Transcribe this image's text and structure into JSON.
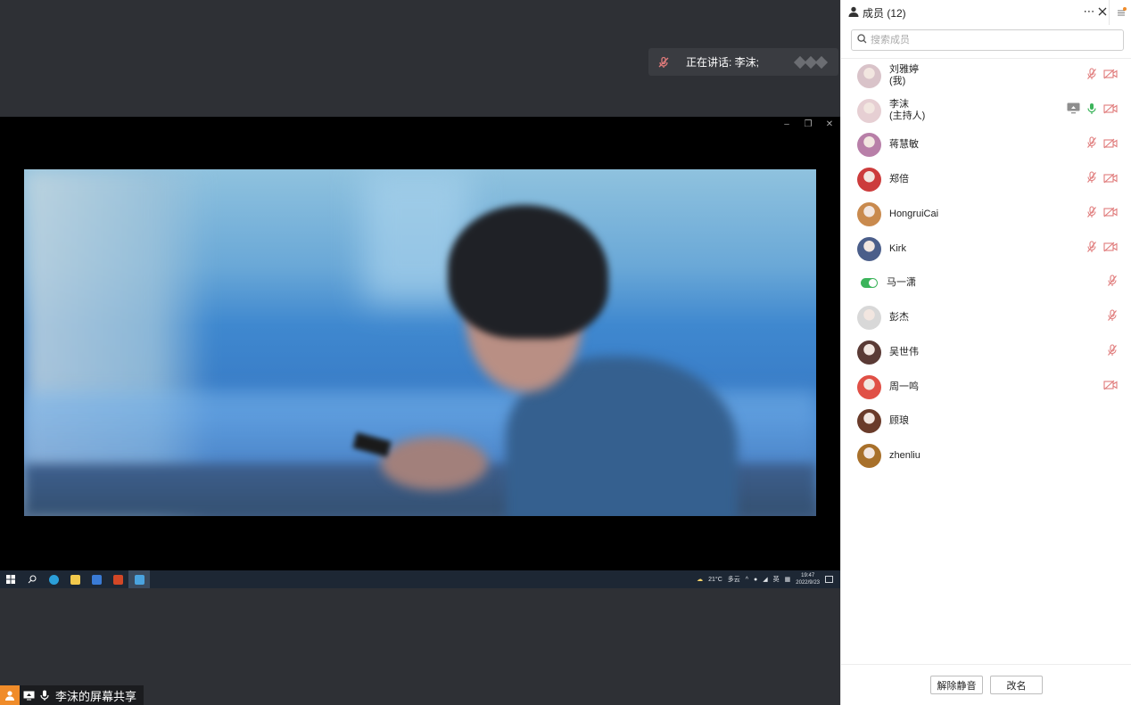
{
  "speaking_banner": {
    "text": "正在讲话: 李沫;"
  },
  "bottom_bar": {
    "share_label": "李沫的屏幕共享"
  },
  "taskbar": {
    "weather": "21°C",
    "weather_text": "多云",
    "ime": "英",
    "time": "19:47",
    "date": "2022/9/23"
  },
  "panel": {
    "title": "成员 (12)",
    "search_placeholder": "搜索成员",
    "colors": {
      "mic_muted": "#e07b7b",
      "cam_off": "#e07b7b",
      "mic_on": "#3cb45b",
      "neutral_icon": "#999999"
    },
    "members": [
      {
        "name": "刘雅婷",
        "sub": "(我)",
        "avatar_color": "#d9c3c9",
        "icons": [
          "mic-muted-icon",
          "camera-off-icon"
        ]
      },
      {
        "name": "李沫",
        "sub": "(主持人)",
        "avatar_color": "#e6cfd3",
        "icons": [
          "screen-share-icon",
          "mic-on-icon",
          "camera-off-icon"
        ]
      },
      {
        "name": "蒋慧敏",
        "sub": "",
        "avatar_color": "#b87fa8",
        "icons": [
          "mic-muted-icon",
          "camera-off-icon"
        ]
      },
      {
        "name": "郑倍",
        "sub": "",
        "avatar_color": "#cc3c3c",
        "icons": [
          "mic-muted-icon",
          "camera-off-icon"
        ]
      },
      {
        "name": "HongruiCai",
        "sub": "",
        "avatar_color": "#c98a4e",
        "icons": [
          "mic-muted-icon",
          "camera-off-icon"
        ]
      },
      {
        "name": "Kirk",
        "sub": "",
        "avatar_color": "#4b5e8a",
        "icons": [
          "mic-muted-icon",
          "camera-off-icon"
        ]
      },
      {
        "name": "马一潇",
        "sub": "",
        "avatar_color": "toggle",
        "icons": [
          "mic-muted-icon"
        ]
      },
      {
        "name": "彭杰",
        "sub": "",
        "avatar_color": "#d8d8d8",
        "icons": [
          "mic-muted-icon"
        ]
      },
      {
        "name": "吴世伟",
        "sub": "",
        "avatar_color": "#5a3a35",
        "icons": [
          "mic-muted-icon"
        ]
      },
      {
        "name": "周一鸣",
        "sub": "",
        "avatar_color": "#e05046",
        "icons": [
          "camera-off-icon"
        ]
      },
      {
        "name": "顾琅",
        "sub": "",
        "avatar_color": "#6a3b2a",
        "icons": []
      },
      {
        "name": "zhenliu",
        "sub": "",
        "avatar_color": "#a8702a",
        "icons": []
      }
    ],
    "footer": {
      "unmute_label": "解除静音",
      "rename_label": "改名"
    }
  }
}
